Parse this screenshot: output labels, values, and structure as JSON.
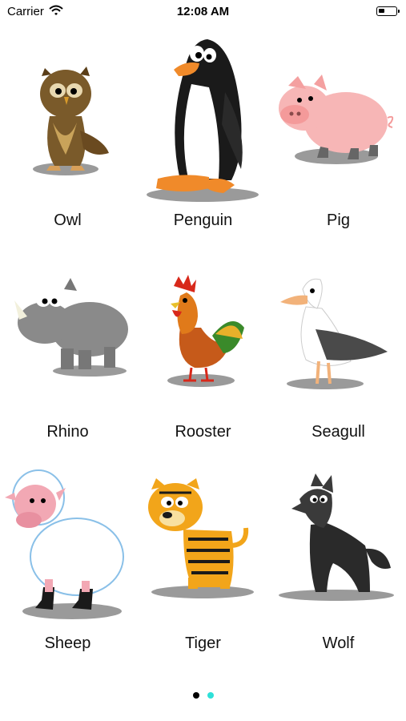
{
  "status_bar": {
    "carrier": "Carrier",
    "time": "12:08 AM"
  },
  "animals": [
    {
      "label": "Owl"
    },
    {
      "label": "Penguin"
    },
    {
      "label": "Pig"
    },
    {
      "label": "Rhino"
    },
    {
      "label": "Rooster"
    },
    {
      "label": "Seagull"
    },
    {
      "label": "Sheep"
    },
    {
      "label": "Tiger"
    },
    {
      "label": "Wolf"
    }
  ],
  "pagination": {
    "pages": 2,
    "current": 1,
    "active_color": "#000000",
    "inactive_color": "#2ee0d8"
  }
}
